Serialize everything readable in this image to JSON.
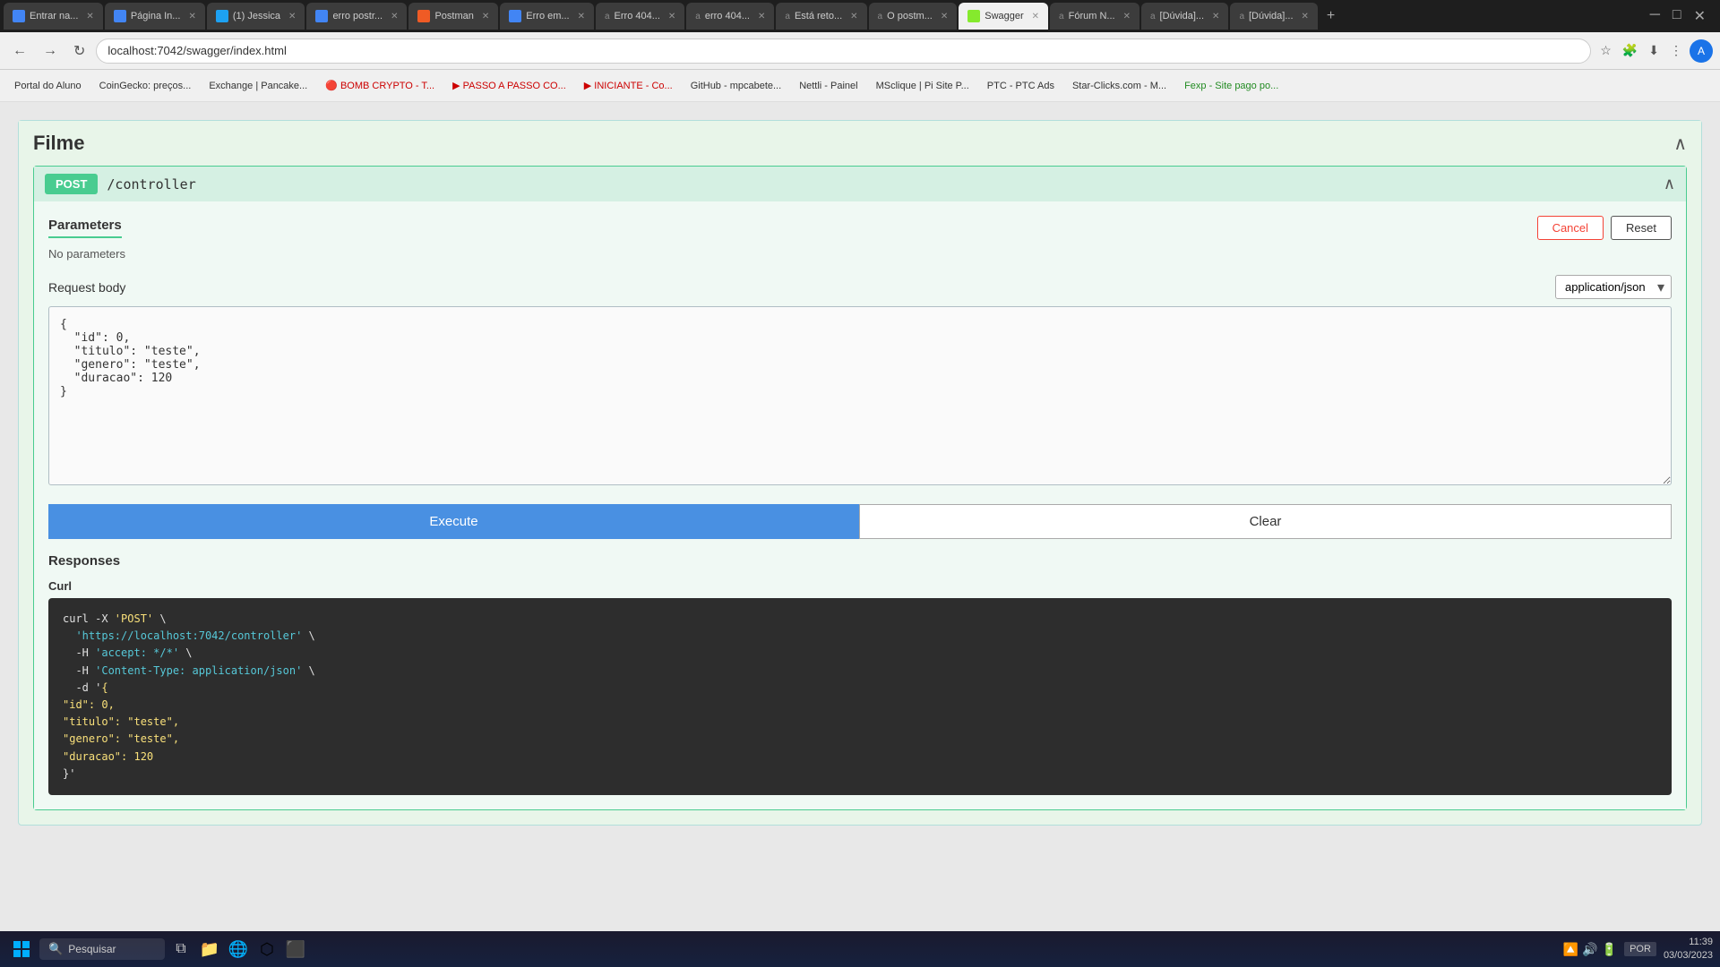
{
  "browser": {
    "url": "localhost:7042/swagger/index.html",
    "tabs": [
      {
        "label": "Entrar na...",
        "active": false,
        "color": "#4285F4"
      },
      {
        "label": "Página In...",
        "active": false,
        "color": "#4285F4"
      },
      {
        "label": "(1) Jessica",
        "active": false,
        "color": "#1DA1F2"
      },
      {
        "label": "erro postr...",
        "active": false,
        "color": "#4285F4"
      },
      {
        "label": "Postman",
        "active": false,
        "color": "#EF5B25"
      },
      {
        "label": "Erro em...",
        "active": false,
        "color": "#4285F4"
      },
      {
        "label": "a Erro 404...",
        "active": false,
        "color": "#4285F4"
      },
      {
        "label": "a erro 404...",
        "active": false,
        "color": "#4285F4"
      },
      {
        "label": "a Está reto...",
        "active": false,
        "color": "#4285F4"
      },
      {
        "label": "a O postm...",
        "active": false,
        "color": "#4285F4"
      },
      {
        "label": "Swagger",
        "active": true,
        "color": "#85EA2D"
      },
      {
        "label": "a Fórum N...",
        "active": false,
        "color": "#4285F4"
      },
      {
        "label": "a [Dúvida]...",
        "active": false,
        "color": "#4285F4"
      },
      {
        "label": "a [Dúvida]...",
        "active": false,
        "color": "#4285F4"
      }
    ],
    "bookmarks": [
      {
        "label": "Portal do Aluno"
      },
      {
        "label": "CoinGecko: preços..."
      },
      {
        "label": "Exchange | Pancake..."
      },
      {
        "label": "BOMB CRYPTO - T..."
      },
      {
        "label": "PASSO A PASSO CO..."
      },
      {
        "label": "INICIANTE - Co..."
      },
      {
        "label": "GitHub - mpcabete..."
      },
      {
        "label": "Nettli - Painel"
      },
      {
        "label": "MSclique | Pi Site P..."
      },
      {
        "label": "PTC - PTC Ads"
      },
      {
        "label": "Star-Clicks.com - M..."
      },
      {
        "label": "Fexp - Site pago po..."
      }
    ]
  },
  "swagger": {
    "section_title": "Filme",
    "endpoint": {
      "method": "POST",
      "path": "/controller",
      "params_title": "Parameters",
      "cancel_label": "Cancel",
      "reset_label": "Reset",
      "no_params": "No parameters",
      "req_body_label": "Request body",
      "content_type": "application/json",
      "json_body": "{\n  \"id\": 0,\n  \"titulo\": \"teste\",\n  \"genero\": \"teste\",\n  \"duracao\": 120\n}",
      "execute_label": "Execute",
      "clear_label": "Clear",
      "responses_title": "Responses",
      "curl_label": "Curl",
      "curl_code": "curl -X 'POST' \\\n  'https://localhost:7042/controller' \\\n  -H 'accept: */*' \\\n  -H 'Content-Type: application/json' \\\n  -d '{\n\"id\": 0,\n\"titulo\": \"teste\",\n\"genero\": \"teste\",\n\"duracao\": 120\n}'"
    }
  },
  "taskbar": {
    "search_placeholder": "Pesquisar",
    "time": "11:39",
    "date": "03/03/2023",
    "language": "POR"
  }
}
